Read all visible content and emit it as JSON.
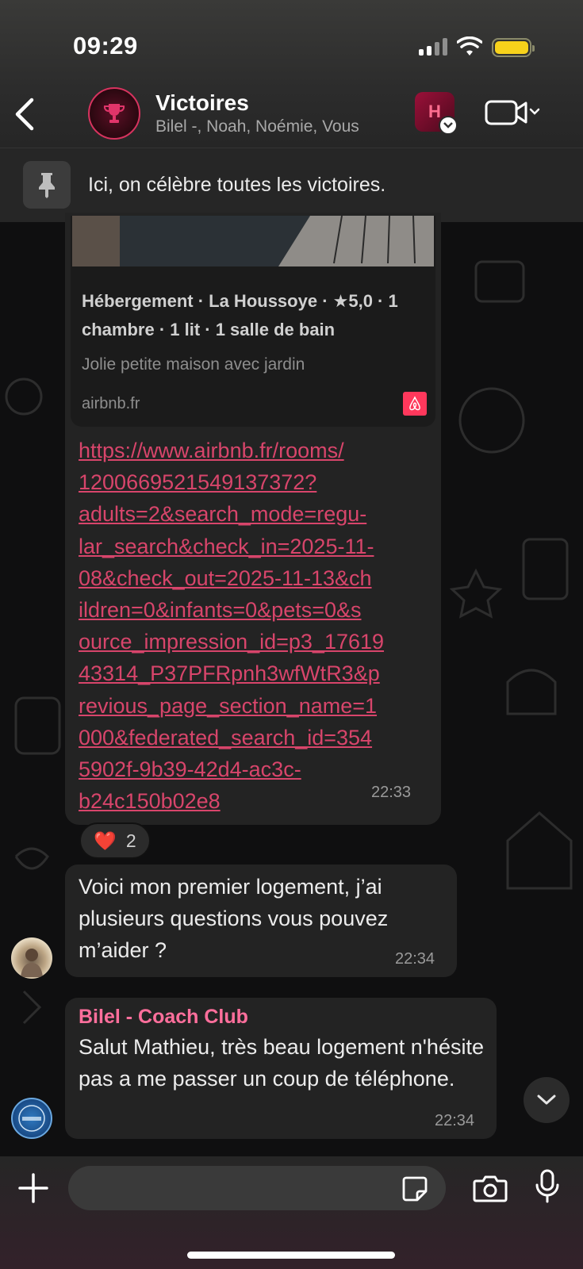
{
  "status_bar": {
    "time": "09:29"
  },
  "header": {
    "title": "Victoires",
    "members": "Bilel -, Noah, Noémie, Vous",
    "app_icon_letter": "H"
  },
  "pinned": {
    "text": "Ici, on célèbre toutes les victoires."
  },
  "link_message": {
    "preview_title": "Hébergement · La Houssoye · ★5,0 · 1 chambre · 1 lit · 1 salle de bain",
    "preview_description": "Jolie petite maison avec jardin",
    "preview_domain": "airbnb.fr",
    "url": "https://www.airbnb.fr/rooms/\n1200669521549137372?\nadults=2&search_mode=regu-\nlar_search&check_in=2025-11-\n08&check_out=2025-11-13&ch\nildren=0&infants=0&pets=0&s\nource_impression_id=p3_17619\n43314_P37PFRpnh3wfWtR3&p\nrevious_page_section_name=1\n000&federated_search_id=354\n5902f-9b39-42d4-ac3c-\nb24c150b02e8",
    "time": "22:33",
    "reaction_emoji": "❤️",
    "reaction_count": "2"
  },
  "message_2": {
    "text": "Voici mon premier logement, j’ai plusieurs questions vous pouvez m’aider ?",
    "time": "22:34"
  },
  "message_3": {
    "sender": "Bilel - Coach Club",
    "text": "Salut Mathieu, très beau logement n'hésite pas a me passer un coup de téléphone.",
    "time": "22:34"
  },
  "composer": {
    "placeholder": ""
  },
  "colors": {
    "accent_pink": "#d8456b",
    "sender_pink": "#ff6f9c",
    "battery": "#f7d21b",
    "airbnb": "#ff385c",
    "bubble": "#232323"
  },
  "icons": [
    "back-chevron-icon",
    "trophy-icon",
    "video-camera-icon",
    "pin-icon",
    "airbnb-icon",
    "chevron-down-icon",
    "plus-icon",
    "sticker-icon",
    "camera-icon",
    "microphone-icon"
  ]
}
